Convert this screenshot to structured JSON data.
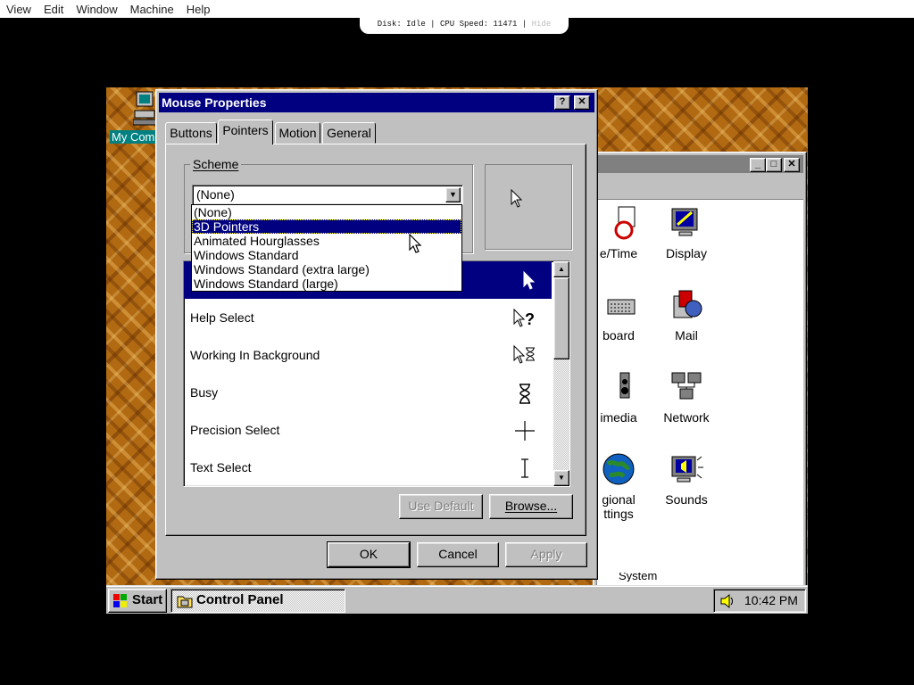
{
  "host_menu": [
    "View",
    "Edit",
    "Window",
    "Machine",
    "Help"
  ],
  "status": {
    "disk": "Disk: Idle",
    "cpu": "CPU Speed: 11471",
    "hide": "Hide",
    "sep": "|"
  },
  "desktop": {
    "my_computer_label": "My Com"
  },
  "control_panel": {
    "title": "",
    "items": [
      {
        "label": "e/Time",
        "label2": ""
      },
      {
        "label": "Display",
        "label2": ""
      },
      {
        "label": "board",
        "label2": ""
      },
      {
        "label": "Mail",
        "label2": ""
      },
      {
        "label": "imedia",
        "label2": ""
      },
      {
        "label": "Network",
        "label2": ""
      },
      {
        "label": "gional",
        "label2": "ttings"
      },
      {
        "label": "Sounds",
        "label2": ""
      }
    ],
    "bottom_text": "System"
  },
  "dialog": {
    "title": "Mouse Properties",
    "help_btn": "?",
    "close_btn": "✕",
    "tabs": [
      "Buttons",
      "Pointers",
      "Motion",
      "General"
    ],
    "active_tab": "Pointers",
    "scheme_label": "Scheme",
    "scheme_value": "(None)",
    "scheme_options": [
      "(None)",
      "3D Pointers",
      "Animated Hourglasses",
      "Windows Standard",
      "Windows Standard (extra large)",
      "Windows Standard (large)"
    ],
    "selected_option": "3D Pointers",
    "cursor_rows": [
      {
        "label": "",
        "icon": "arrow-cursor-icon"
      },
      {
        "label": "Help Select",
        "icon": "help-select-cursor-icon"
      },
      {
        "label": "Working In Background",
        "icon": "working-background-cursor-icon"
      },
      {
        "label": "Busy",
        "icon": "hourglass-cursor-icon"
      },
      {
        "label": "Precision Select",
        "icon": "crosshair-cursor-icon"
      },
      {
        "label": "Text Select",
        "icon": "ibeam-cursor-icon"
      }
    ],
    "use_default": "Use Default",
    "browse": "Browse...",
    "ok": "OK",
    "cancel": "Cancel",
    "apply": "Apply"
  },
  "taskbar": {
    "start": "Start",
    "task": "Control Panel",
    "time": "10:42 PM"
  },
  "colors": {
    "titlebar": "#000080",
    "face": "#c0c0c0",
    "desktop": "#b26a12"
  }
}
